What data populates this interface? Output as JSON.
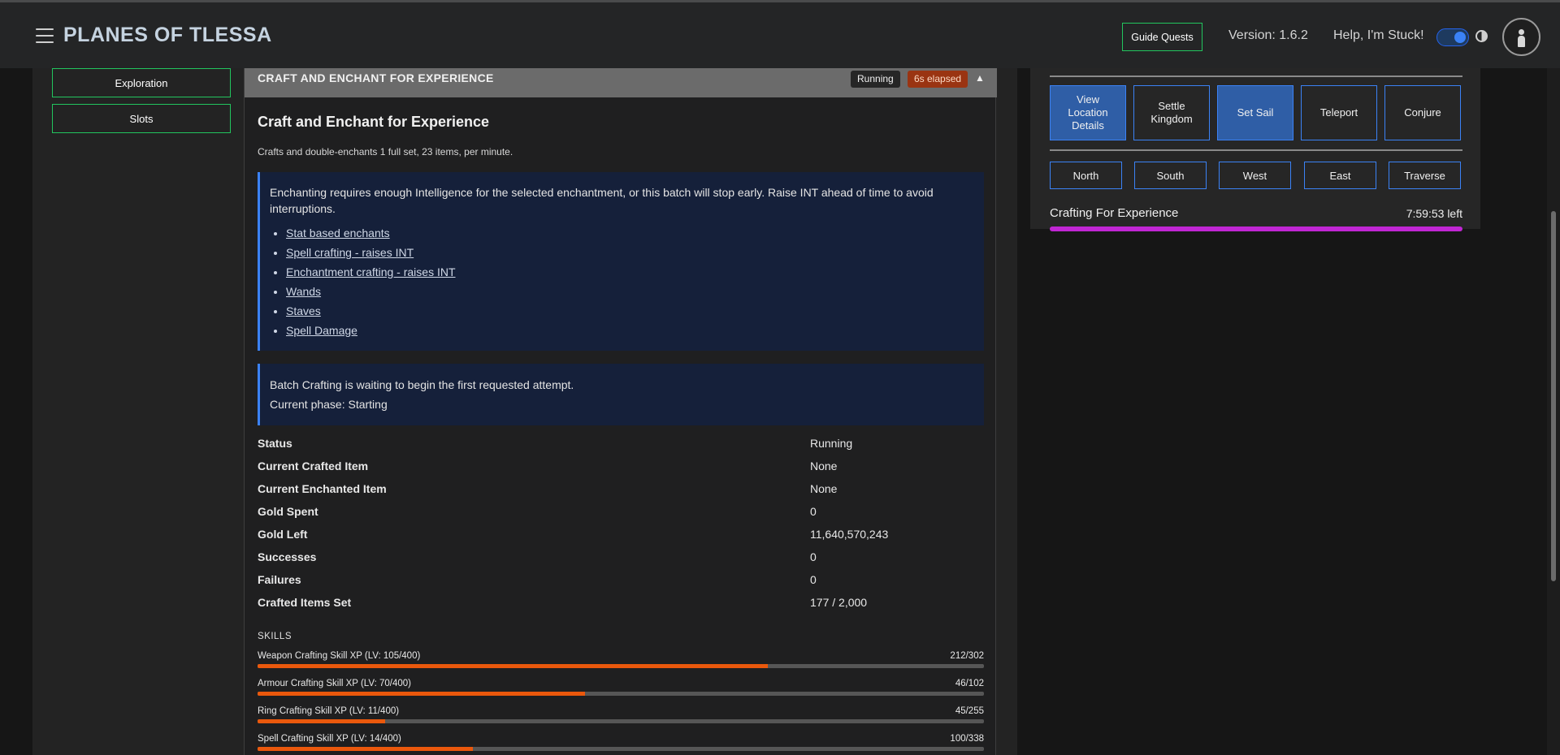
{
  "header": {
    "title": "PLANES OF TLESSA",
    "guide_quests": "Guide Quests",
    "version": "Version: 1.6.2",
    "help": "Help, I'm Stuck!"
  },
  "sidebar": {
    "buttons": [
      "Exploration",
      "Slots"
    ]
  },
  "craft": {
    "header_title": "CRAFT AND ENCHANT FOR EXPERIENCE",
    "status_badge": "Running",
    "elapsed_badge": "6s elapsed",
    "title": "Craft and Enchant for Experience",
    "description": "Crafts and double-enchants 1 full set, 23 items, per minute.",
    "warning": "Enchanting requires enough Intelligence for the selected enchantment, or this batch will stop early. Raise INT ahead of time to avoid interruptions.",
    "links": [
      "Stat based enchants",
      "Spell crafting - raises INT",
      "Enchantment crafting - raises INT",
      "Wands",
      "Staves",
      "Spell Damage"
    ],
    "phase_message": "Batch Crafting is waiting to begin the first requested attempt.",
    "phase": "Current phase: Starting",
    "stats": [
      {
        "label": "Status",
        "value": "Running"
      },
      {
        "label": "Current Crafted Item",
        "value": "None"
      },
      {
        "label": "Current Enchanted Item",
        "value": "None"
      },
      {
        "label": "Gold Spent",
        "value": "0"
      },
      {
        "label": "Gold Left",
        "value": "11,640,570,243"
      },
      {
        "label": "Successes",
        "value": "0"
      },
      {
        "label": "Failures",
        "value": "0"
      },
      {
        "label": "Crafted Items Set",
        "value": "177 / 2,000"
      }
    ],
    "skills_label": "SKILLS",
    "skills": [
      {
        "name": "Weapon Crafting Skill XP (LV: 105/400)",
        "xp": "212/302",
        "progress": 0.702
      },
      {
        "name": "Armour Crafting Skill XP (LV: 70/400)",
        "xp": "46/102",
        "progress": 0.451
      },
      {
        "name": "Ring Crafting Skill XP (LV: 11/400)",
        "xp": "45/255",
        "progress": 0.176
      },
      {
        "name": "Spell Crafting Skill XP (LV: 14/400)",
        "xp": "100/338",
        "progress": 0.296
      }
    ]
  },
  "actions": {
    "buttons": [
      "View Location Details",
      "Settle Kingdom",
      "Set Sail",
      "Teleport",
      "Conjure"
    ],
    "directions": [
      "North",
      "South",
      "West",
      "East",
      "Traverse"
    ],
    "timer_label": "Crafting For Experience",
    "timer_left": "7:59:53 left",
    "timer_progress": 1.0
  },
  "colors": {
    "green_border": "#22c55e",
    "blue_border": "#3b82f6",
    "orange_bar": "#ea580c",
    "purple_bar": "#c026d3",
    "elapsed_badge": "#9a3412"
  }
}
